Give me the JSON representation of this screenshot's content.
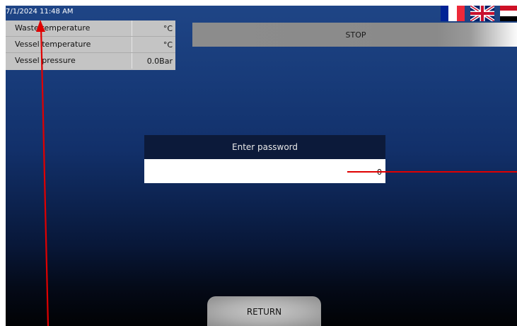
{
  "status_bar": {
    "datetime": "7/1/2024 11:48 AM",
    "languages": [
      {
        "name": "french-flag",
        "colors": [
          "#002395",
          "#ffffff",
          "#ed2939"
        ]
      },
      {
        "name": "uk-flag",
        "colors": [
          "#012169",
          "#ffffff",
          "#c8102e"
        ]
      },
      {
        "name": "egypt-flag",
        "colors": [
          "#ce1126",
          "#ffffff",
          "#000000"
        ]
      }
    ]
  },
  "readings": [
    {
      "label": "Waste temperature",
      "value": "°C"
    },
    {
      "label": "Vessel temperature",
      "value": "°C"
    },
    {
      "label": "Vessel pressure",
      "value": "0.0Bar"
    }
  ],
  "controls": {
    "stop_label": "STOP",
    "return_label": "RETURN"
  },
  "password_dialog": {
    "title": "Enter password",
    "value": "0"
  },
  "colors": {
    "annotation_arrow": "#e00000",
    "background_top": "#1f4586",
    "background_bottom": "#010204"
  }
}
